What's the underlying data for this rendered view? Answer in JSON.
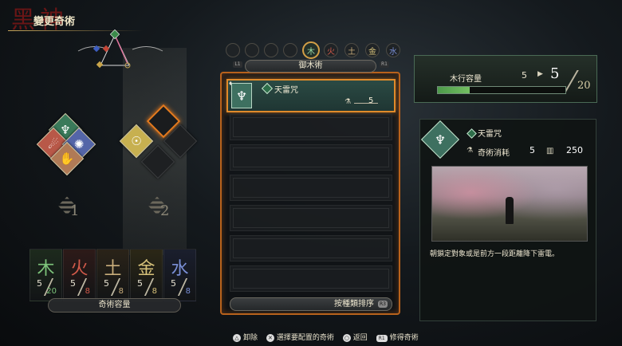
{
  "header": {
    "title": "變更奇術",
    "logo_text": "黑神"
  },
  "mini_diagram": {
    "icon": "element-triangle-icon"
  },
  "slots": [
    {
      "number": "1",
      "icons": [
        "lightning-icon",
        "fire-icon",
        "water-icon",
        "earth-icon"
      ]
    },
    {
      "number": "2",
      "icons": [
        "metal-icon",
        "empty",
        "empty",
        "empty"
      ]
    }
  ],
  "capacity_cards": [
    {
      "symbol": "木",
      "current": "5",
      "max": "20",
      "color": "#7dc47b",
      "bg": "#1d2a1d"
    },
    {
      "symbol": "火",
      "current": "5",
      "max": "8",
      "color": "#d25a4a",
      "bg": "#2d1a18"
    },
    {
      "symbol": "土",
      "current": "5",
      "max": "8",
      "color": "#c9ad7b",
      "bg": "#2a2318"
    },
    {
      "symbol": "金",
      "current": "5",
      "max": "8",
      "color": "#d7c27a",
      "bg": "#2b2716"
    },
    {
      "symbol": "水",
      "current": "5",
      "max": "8",
      "color": "#7a8fd6",
      "bg": "#1a1e2d"
    }
  ],
  "capacity_label": "奇術容量",
  "tabs": {
    "lb": "L1",
    "rb": "R1",
    "items": [
      "",
      "",
      "",
      "",
      "木",
      "火",
      "土",
      "金",
      "水"
    ],
    "active_index": 4,
    "category": "御木術"
  },
  "list": {
    "selected": {
      "name": "天雷咒",
      "cost": "5",
      "icon": "lightning-spell-icon"
    },
    "empty_rows": 7,
    "sort_label": "按種類排序",
    "sort_button": "R3"
  },
  "capacity_panel": {
    "title": "木行容量",
    "current": "5",
    "new": "5",
    "max": "20",
    "fill_fraction": 0.25
  },
  "detail": {
    "name": "天雷咒",
    "cost_label": "奇術消耗",
    "cost": "5",
    "points": "250",
    "description": "朝鎖定對象或是前方一段距離降下雷電。"
  },
  "footer": {
    "unequip": "卸除",
    "select": "選擇要配置的奇術",
    "back": "返回",
    "acquire": "修得奇術"
  },
  "colors": {
    "accent": "#e08a2a",
    "wood": "#7dc47b"
  }
}
